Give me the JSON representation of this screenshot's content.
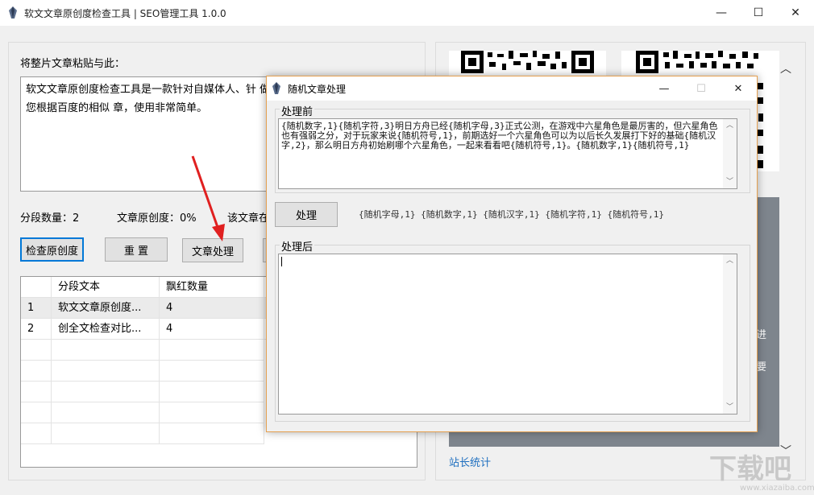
{
  "main_window": {
    "title": "软文文章原创度检查工具 | SEO管理工具  1.0.0",
    "minimize": "—",
    "maximize": "☐",
    "close": "✕"
  },
  "left": {
    "paste_label": "将整片文章粘贴与此：",
    "article_text": "软文文章原创度检查工具是一款针对自媒体人、针 做原创全文检查对比。可以帮助您根据百度的相似 章，使用非常简单。",
    "segment_count": "分段数量：2",
    "originality": "文章原创度：0%",
    "article_status": "该文章在",
    "buttons": {
      "check": "检查原创度",
      "reset": "重 置",
      "process": "文章处理"
    },
    "table": {
      "headers": [
        "",
        "分段文本",
        "飘红数量"
      ],
      "rows": [
        [
          "1",
          "软文文章原创度...",
          "4"
        ],
        [
          "2",
          "创全文检查对比...",
          "4"
        ]
      ]
    }
  },
  "right": {
    "stats_link": "站长统计",
    "scroll_up": "︿",
    "scroll_down": "﹀",
    "card_text_1": "进",
    "card_text_2": "要"
  },
  "dialog": {
    "title": "随机文章处理",
    "before_label": "处理前",
    "before_text": "{随机数字,1}{随机字符,3}明日方舟已经{随机字母,3}正式公测，在游戏中六星角色是最厉害的，但六星角色也有强弱之分，对于玩家来说{随机符号,1}，前期选好一个六星角色可以为以后长久发展打下好的基础{随机汉字,2}，那么明日方舟初始刷哪个六星角色，一起来看看吧{随机符号,1}。{随机数字,1}{随机符号,1}",
    "process_button": "处理",
    "tags": [
      "{随机字母,1}",
      "{随机数字,1}",
      "{随机汉字,1}",
      "{随机字符,1}",
      "{随机符号,1}"
    ],
    "after_label": "处理后",
    "after_text": "",
    "minimize": "—",
    "maximize": "☐",
    "close": "✕"
  },
  "watermark": {
    "big": "下载吧",
    "small": "www.xiazaiba.com"
  }
}
